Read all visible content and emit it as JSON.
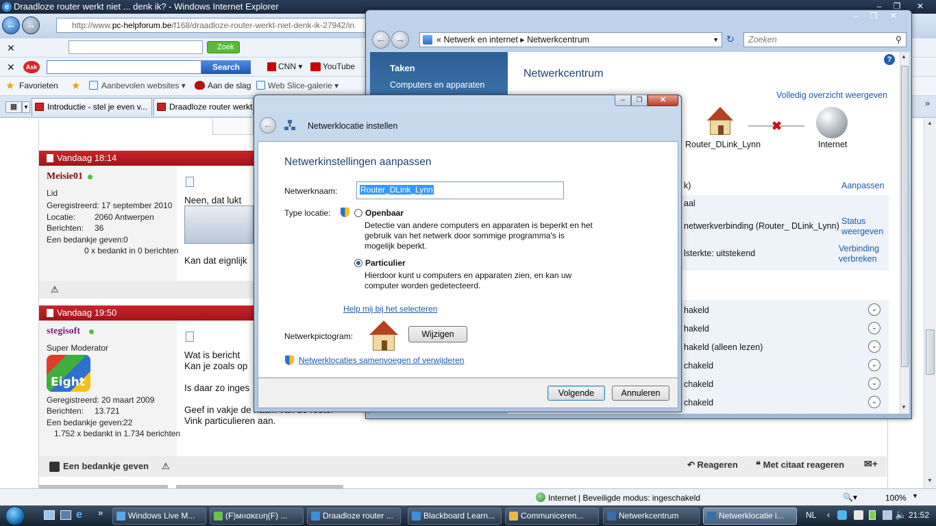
{
  "ie": {
    "title": "Draadloze router werkt niet ... denk ik? - Windows Internet Explorer",
    "address_prefix": "http://www.",
    "address_domain": "pc-helpforum.be",
    "address_rest": "/f168/draadloze-router-werkt-niet-denk-ik-27942/in",
    "zoek_label": "Zoek",
    "ask_search_button": "Search",
    "toolbar_links": [
      "CNN",
      "YouTube"
    ],
    "favorites_label": "Favorieten",
    "favbar_items": [
      "Aanbevolen websites",
      "Aan de slag",
      "Web Slice-galerie"
    ],
    "tabs": [
      "Introductie - stel je even v...",
      "Draadloze router werkt"
    ],
    "status": "Internet | Beveiligde modus: ingeschakeld",
    "zoom": "100%"
  },
  "forum": {
    "post1": {
      "time": "Vandaag 18:14",
      "user": "Meisie01",
      "role": "Lid",
      "info": [
        [
          "Geregistreerd:",
          "17 september 2010"
        ],
        [
          "Locatie:",
          "2060 Antwerpen"
        ],
        [
          "Berichten:",
          "36"
        ],
        [
          "Een bedankje geven:",
          "0"
        ]
      ],
      "thanks": "0 x bedankt in 0 berichten",
      "text1": "Neen, dat lukt",
      "text2": "Kan dat eignlijk"
    },
    "post2": {
      "time": "Vandaag 19:50",
      "user": "stegisoft",
      "role": "Super Moderator",
      "avatar_text": "Eight",
      "info": [
        [
          "Geregistreerd:",
          "20 maart 2009"
        ],
        [
          "Berichten:",
          "13.721"
        ],
        [
          "Een bedankje geven:",
          "22"
        ]
      ],
      "thanks": "1.752 x bedankt in 1.734 berichten",
      "lines": [
        "Wat is bericht",
        "Kan je zoals op",
        "Is daar zo inges",
        "Geef in vakje de naam van de router",
        "Vink particulieren aan."
      ],
      "footer": {
        "thanks_button": "Een bedankje geven",
        "reply": "Reageren",
        "quote_reply": "Met citaat reageren"
      }
    }
  },
  "netcenter": {
    "breadcrumb": [
      "Netwerk en internet",
      "Netwerkcentrum"
    ],
    "search_placeholder": "Zoeken",
    "side_title": "Taken",
    "side_items": [
      "Computers en apparaten"
    ],
    "title": "Netwerkcentrum",
    "overview_link": "Volledig overzicht weergeven",
    "map_nodes": [
      "Router_DLink_Lynn",
      "Internet"
    ],
    "customize_link": "Aanpassen",
    "rows": [
      {
        "text": "k)",
        "link": ""
      },
      {
        "text": "aal",
        "link": ""
      },
      {
        "text": "netwerkverbinding (Router_ DLink_Lynn)",
        "link": "Status weergeven"
      },
      {
        "text": "lsterkte: uitstekend",
        "link": "Verbinding verbreken"
      }
    ],
    "settings": [
      "hakeld",
      "hakeld",
      "hakeld (alleen lezen)",
      "chakeld",
      "chakeld",
      "chakeld"
    ]
  },
  "dialog": {
    "title": "Netwerklocatie instellen",
    "heading": "Netwerkinstellingen aanpassen",
    "name_label": "Netwerknaam:",
    "name_value": "Router_DLink_Lynn",
    "type_label": "Type locatie:",
    "public_label": "Openbaar",
    "public_desc": [
      "Detectie van andere computers en apparaten is beperkt en het",
      "gebruik van het netwerk door sommige programma's is",
      "mogelijk beperkt."
    ],
    "private_label": "Particulier",
    "private_desc": [
      "Hierdoor kunt u computers en apparaten zien, en kan uw",
      "computer worden gedetecteerd."
    ],
    "help_link": "Help mij bij het selecteren",
    "icon_label": "Netwerkpictogram:",
    "change_button": "Wijzigen",
    "merge_link": "Netwerklocaties samenvoegen of verwijderen",
    "next_button": "Volgende",
    "cancel_button": "Annuleren"
  },
  "taskbar": {
    "items": [
      "Windows Live M...",
      "(F)мııακευη(F) ...",
      "Draadloze router ...",
      "Blackboard Learn...",
      "Communiceren...",
      "Netwerkcentrum",
      "Netwerklocatie i..."
    ],
    "lang": "NL",
    "clock": "21:52"
  }
}
